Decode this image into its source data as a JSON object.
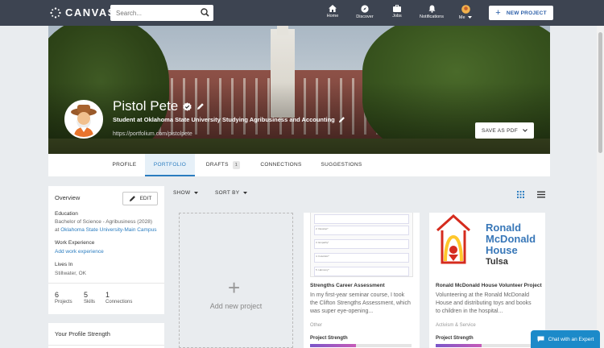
{
  "header": {
    "logo_text": "CANVAS",
    "search_placeholder": "Search...",
    "nav": [
      {
        "label": "Home",
        "icon": "home-icon"
      },
      {
        "label": "Discover",
        "icon": "compass-icon"
      },
      {
        "label": "Jobs",
        "icon": "briefcase-icon"
      },
      {
        "label": "Notifications",
        "icon": "bell-icon"
      },
      {
        "label": "Me",
        "icon": "avatar"
      }
    ],
    "new_project_label": "NEW PROJECT"
  },
  "profile": {
    "name": "Pistol Pete",
    "headline": "Student at Oklahoma State University Studying Agribusiness and Accounting",
    "url": "https://portfolium.com/pistolpete",
    "save_pdf_label": "SAVE AS PDF"
  },
  "tabs": [
    {
      "label": "PROFILE"
    },
    {
      "label": "PORTFOLIO",
      "active": true
    },
    {
      "label": "DRAFTS",
      "badge": "1"
    },
    {
      "label": "CONNECTIONS"
    },
    {
      "label": "SUGGESTIONS"
    }
  ],
  "overview": {
    "title": "Overview",
    "edit_label": "EDIT",
    "education_label": "Education",
    "education_degree": "Bachelor of Science - Agribusiness (2028)",
    "education_at": "at",
    "education_school": "Oklahoma State University-Main Campus",
    "work_label": "Work Experience",
    "work_link": "Add work experience",
    "lives_label": "Lives In",
    "lives_value": "Stillwater, OK",
    "stats": [
      {
        "value": "6",
        "label": "Projects"
      },
      {
        "value": "5",
        "label": "Skills"
      },
      {
        "value": "1",
        "label": "Connections"
      }
    ]
  },
  "strength_card_title": "Your Profile Strength",
  "controls": {
    "show_label": "SHOW",
    "sort_label": "SORT BY"
  },
  "add_project_label": "Add new project",
  "projects": [
    {
      "title": "Strengths Career Assessment",
      "description": "In my first-year seminar course, I took the Clifton Strengths Assessment, which was super eye-opening...",
      "category": "Other",
      "strength_label": "Project Strength",
      "strength_value": 0.45,
      "thumb_items": [
        "2. Develop*",
        "3. Empathy*",
        "4. Futuristic*",
        "5. Harmony*"
      ]
    },
    {
      "title": "Ronald McDonald House Volunteer Project",
      "description": "Volunteering at the Ronald McDonald House and distributing toys and books to children in the hospital...",
      "category": "Activism & Service",
      "strength_label": "Project Strength",
      "strength_value": 0.45,
      "thumb_lines": [
        "Ronald",
        "McDonald",
        "House",
        "Tulsa"
      ]
    }
  ],
  "chat_label": "Chat with an Expert",
  "colors": {
    "topbar": "#3d4451",
    "accent": "#2b7dc0",
    "chat": "#1c8ac9"
  }
}
